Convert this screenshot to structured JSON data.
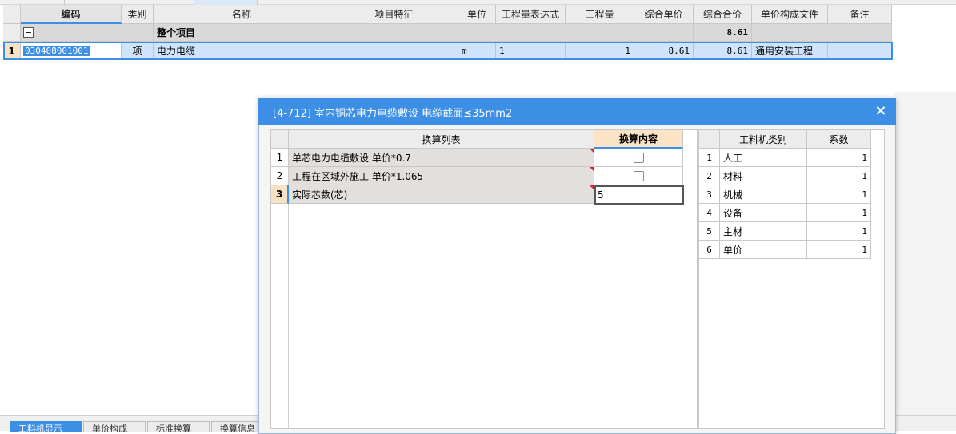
{
  "grid": {
    "headers": [
      "编码",
      "类别",
      "名称",
      "项目特征",
      "单位",
      "工程量表达式",
      "工程量",
      "综合单价",
      "综合合价",
      "单价构成文件",
      "备注"
    ],
    "group_row": {
      "toggle": "−",
      "name": "整个项目",
      "total": "8.61"
    },
    "rows": [
      {
        "num": "1",
        "code": "030408001001",
        "type": "项",
        "name": "电力电缆",
        "feature": "",
        "unit": "m",
        "expr": "1",
        "qty": "1",
        "unit_price": "8.61",
        "total_price": "8.61",
        "file": "通用安装工程",
        "note": ""
      }
    ]
  },
  "dialog": {
    "title": "[4-712] 室内铜芯电力电缆敷设 电缆截面≤35mm2",
    "close_glyph": "×",
    "conv_headers": {
      "list": "换算列表",
      "content": "换算内容"
    },
    "conversions": [
      {
        "num": "1",
        "label": "单芯电力电缆敷设 单价*0.7",
        "kind": "checkbox",
        "checked": false
      },
      {
        "num": "2",
        "label": "工程在区域外施工 单价*1.065",
        "kind": "checkbox",
        "checked": false
      },
      {
        "num": "3",
        "label": "实际芯数(芯)",
        "kind": "input",
        "value": "5"
      }
    ],
    "factor_headers": {
      "category": "工料机类别",
      "coef": "系数"
    },
    "factors": [
      {
        "num": "1",
        "category": "人工",
        "coef": "1"
      },
      {
        "num": "2",
        "category": "材料",
        "coef": "1"
      },
      {
        "num": "3",
        "category": "机械",
        "coef": "1"
      },
      {
        "num": "4",
        "category": "设备",
        "coef": "1"
      },
      {
        "num": "5",
        "category": "主材",
        "coef": "1"
      },
      {
        "num": "6",
        "category": "单价",
        "coef": "1"
      }
    ]
  },
  "bottom_tabs": [
    {
      "label": "工料机显示",
      "active": true
    },
    {
      "label": "单价构成",
      "active": false
    },
    {
      "label": "标准换算",
      "active": false
    },
    {
      "label": "换算信息",
      "active": false
    }
  ],
  "colors": {
    "accent": "#3d8fe6",
    "selection": "#cfe3fb",
    "group_row": "#d9d9d9",
    "mark": "#e02020"
  }
}
